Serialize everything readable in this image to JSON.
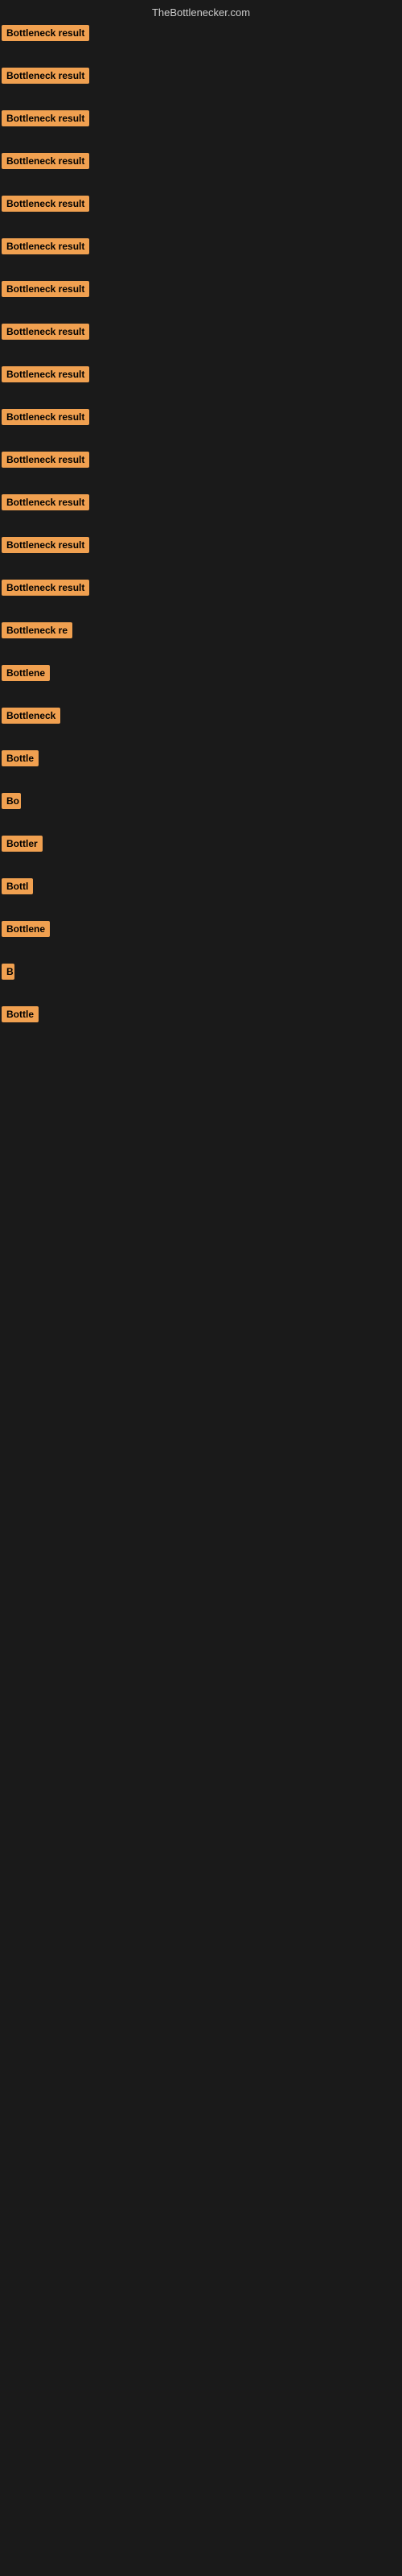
{
  "header": {
    "title": "TheBottlenecker.com"
  },
  "items": [
    {
      "label": "Bottleneck result",
      "width": 115
    },
    {
      "label": "Bottleneck result",
      "width": 115
    },
    {
      "label": "Bottleneck result",
      "width": 115
    },
    {
      "label": "Bottleneck result",
      "width": 115
    },
    {
      "label": "Bottleneck result",
      "width": 115
    },
    {
      "label": "Bottleneck result",
      "width": 115
    },
    {
      "label": "Bottleneck result",
      "width": 115
    },
    {
      "label": "Bottleneck result",
      "width": 115
    },
    {
      "label": "Bottleneck result",
      "width": 115
    },
    {
      "label": "Bottleneck result",
      "width": 115
    },
    {
      "label": "Bottleneck result",
      "width": 115
    },
    {
      "label": "Bottleneck result",
      "width": 115
    },
    {
      "label": "Bottleneck result",
      "width": 115
    },
    {
      "label": "Bottleneck result",
      "width": 115
    },
    {
      "label": "Bottleneck re",
      "width": 95
    },
    {
      "label": "Bottlene",
      "width": 74
    },
    {
      "label": "Bottleneck",
      "width": 80
    },
    {
      "label": "Bottle",
      "width": 55
    },
    {
      "label": "Bo",
      "width": 24
    },
    {
      "label": "Bottler",
      "width": 57
    },
    {
      "label": "Bottl",
      "width": 46
    },
    {
      "label": "Bottlene",
      "width": 68
    },
    {
      "label": "B",
      "width": 16
    },
    {
      "label": "Bottle",
      "width": 52
    }
  ]
}
